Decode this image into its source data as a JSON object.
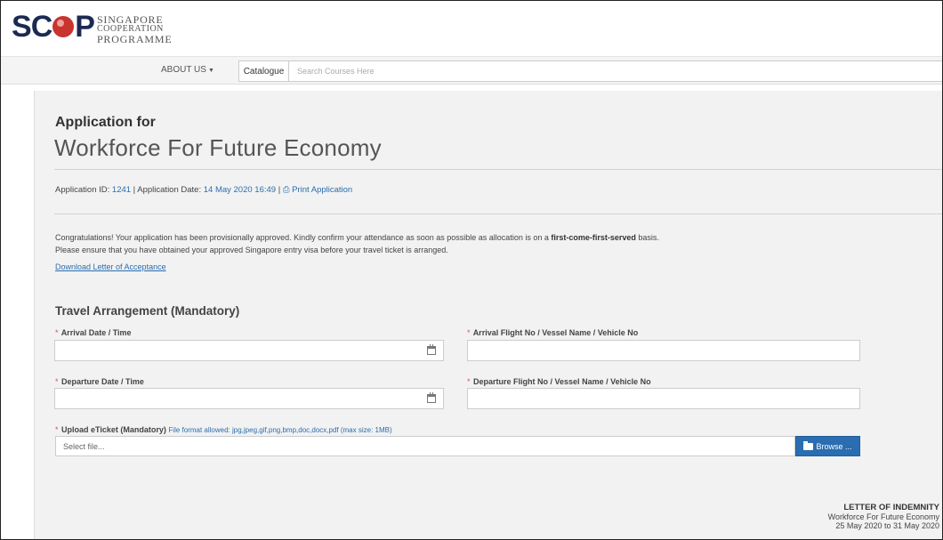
{
  "brand": {
    "mark": "SCP",
    "line1": "SINGAPORE",
    "line2": "COOPERATION",
    "line3": "PROGRAMME"
  },
  "nav": {
    "about_label": "ABOUT US",
    "catalogue_label": "Catalogue",
    "search_placeholder": "Search Courses Here"
  },
  "application": {
    "heading": "Application for",
    "title": "Workforce For Future Economy",
    "id_label": "Application ID: ",
    "id_value": "1241",
    "date_label": " | Application Date: ",
    "date_value": "14 May 2020 16:49",
    "sep": " | ",
    "print_label": "Print Application"
  },
  "message": {
    "line1_pre": "Congratulations! Your application has been provisionally approved. Kindly confirm your attendance as soon as possible as allocation is on a ",
    "line1_bold": "first-come-first-served",
    "line1_post": " basis.",
    "line2": "Please ensure that you have obtained your approved Singapore entry visa before your travel ticket is arranged.",
    "download_link": "Download Letter of Acceptance"
  },
  "travel": {
    "section_title": "Travel Arrangement (Mandatory)",
    "required_mark": "*",
    "arrival_date_label": "Arrival Date / Time",
    "arrival_date_value": "",
    "arrival_flight_label": "Arrival Flight No / Vessel Name / Vehicle No",
    "arrival_flight_value": "",
    "departure_date_label": "Departure Date / Time",
    "departure_date_value": "",
    "departure_flight_label": "Departure Flight No / Vessel Name / Vehicle No",
    "departure_flight_value": "",
    "upload_label": "Upload eTicket (Mandatory)",
    "upload_hint": "File format allowed: jpg,jpeg,gif,png,bmp,doc,docx,pdf (max size: 1MB)",
    "file_placeholder": "Select file...",
    "browse_label": "Browse ..."
  },
  "indemnity": {
    "title": "LETTER OF INDEMNITY",
    "course": "Workforce For Future Economy",
    "dates": "25 May 2020 to 31 May 2020"
  }
}
